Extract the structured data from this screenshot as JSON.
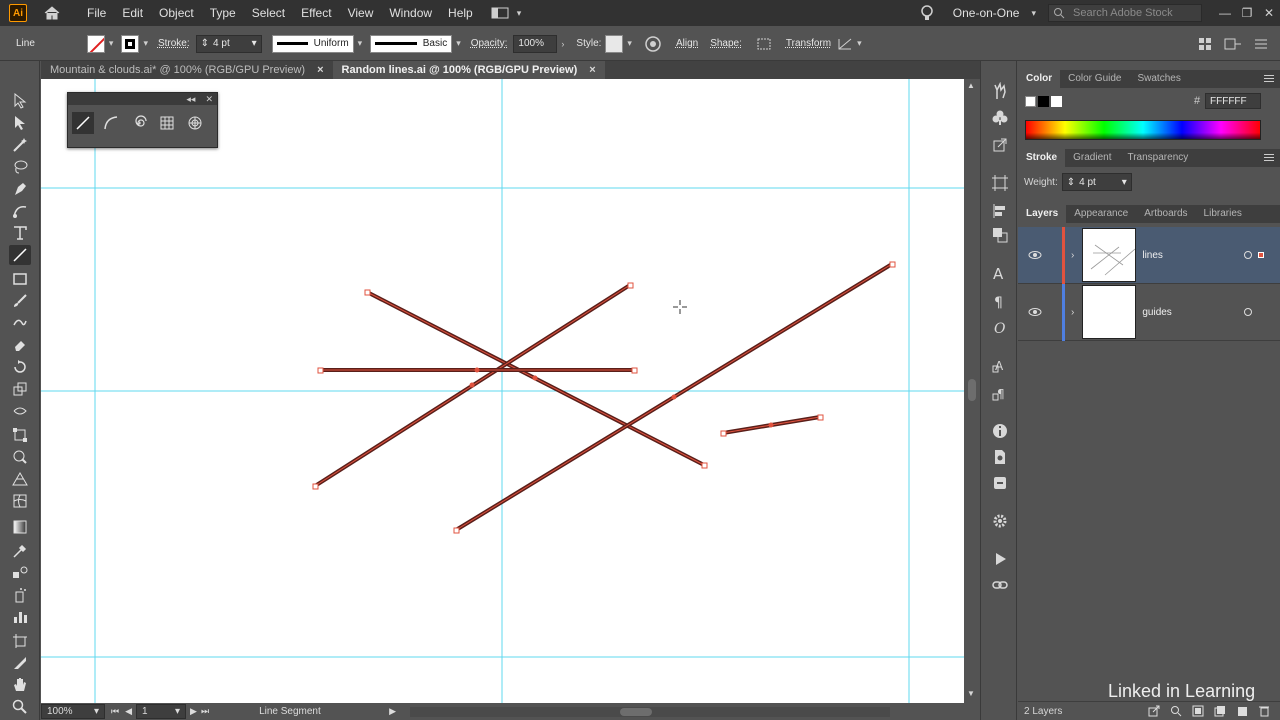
{
  "menubar": {
    "app_logo": "Ai",
    "items": [
      "File",
      "Edit",
      "Object",
      "Type",
      "Select",
      "Effect",
      "View",
      "Window",
      "Help"
    ],
    "workspace": "One-on-One",
    "search_placeholder": "Search Adobe Stock"
  },
  "controlbar": {
    "tool_name": "Line",
    "stroke_label": "Stroke:",
    "stroke_weight": "4 pt",
    "stroke_profile": "Uniform",
    "brush": "Basic",
    "opacity_label": "Opacity:",
    "opacity": "100%",
    "style_label": "Style:",
    "align": "Align",
    "shape": "Shape:",
    "transform": "Transform"
  },
  "tabs": [
    {
      "label": "Mountain & clouds.ai* @ 100% (RGB/GPU Preview)",
      "active": false
    },
    {
      "label": "Random lines.ai @ 100% (RGB/GPU Preview)",
      "active": true
    }
  ],
  "tab_close": "×",
  "panels": {
    "color_tabs": [
      "Color",
      "Color Guide",
      "Swatches"
    ],
    "hex_symbol": "#",
    "hex_value": "FFFFFF",
    "stroke_tabs": [
      "Stroke",
      "Gradient",
      "Transparency"
    ],
    "weight_label": "Weight:",
    "weight_value": "4 pt",
    "layers_tabs": [
      "Layers",
      "Appearance",
      "Artboards",
      "Libraries"
    ],
    "layers": [
      {
        "name": "lines",
        "color": "#e0533f",
        "selected": true
      },
      {
        "name": "guides",
        "color": "#4f7fe0",
        "selected": false
      }
    ],
    "layers_count": "2 Layers"
  },
  "statusbar": {
    "zoom": "100%",
    "artboard": "1",
    "current_tool": "Line Segment"
  },
  "watermark": "Linked in Learning",
  "colors": {
    "line_stroke": "#5a1f1a",
    "selection": "#e0533f",
    "guide": "#5fd8ef"
  }
}
